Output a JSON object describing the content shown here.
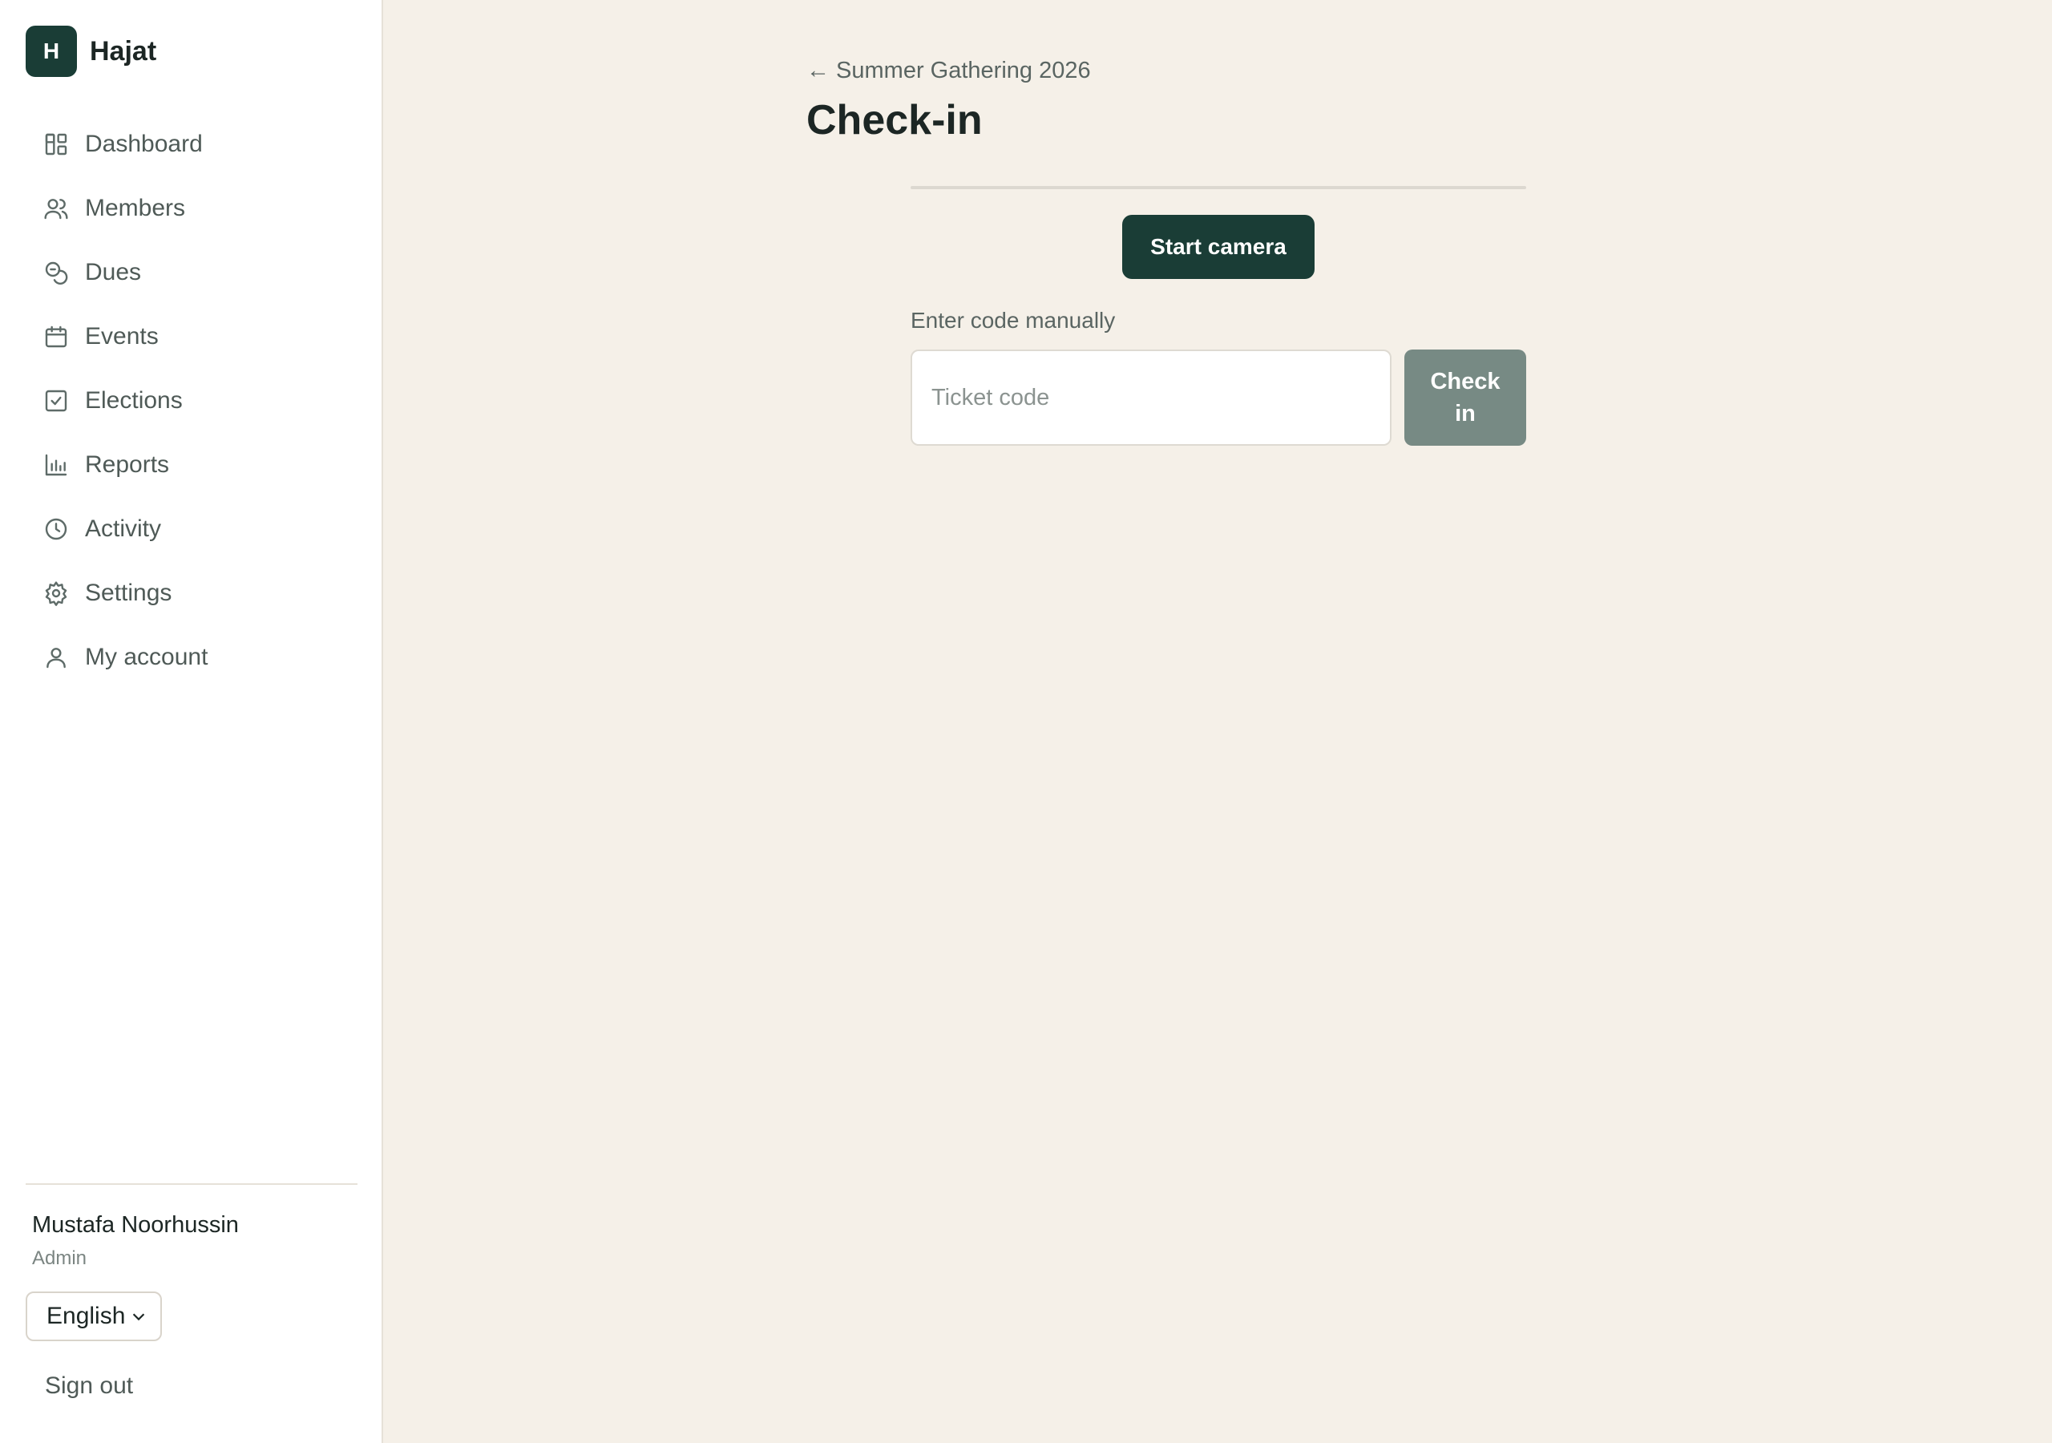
{
  "brand": {
    "initial": "H",
    "name": "Hajat"
  },
  "nav": [
    {
      "label": "Dashboard",
      "icon": "dashboard-icon"
    },
    {
      "label": "Members",
      "icon": "users-icon"
    },
    {
      "label": "Dues",
      "icon": "coins-icon"
    },
    {
      "label": "Events",
      "icon": "calendar-icon"
    },
    {
      "label": "Elections",
      "icon": "ballot-icon"
    },
    {
      "label": "Reports",
      "icon": "bar-chart-icon"
    },
    {
      "label": "Activity",
      "icon": "clock-icon"
    },
    {
      "label": "Settings",
      "icon": "gear-icon"
    },
    {
      "label": "My account",
      "icon": "user-icon"
    }
  ],
  "user": {
    "name": "Mustafa Noorhussin",
    "role": "Admin"
  },
  "language": {
    "selected": "English"
  },
  "sign_out": "Sign out",
  "main": {
    "back_link": "← Summer Gathering 2026",
    "title": "Check-in",
    "start_camera": "Start camera",
    "manual_label": "Enter code manually",
    "ticket_placeholder": "Ticket code",
    "checkin_button": "Check in"
  },
  "colors": {
    "brand": "#1a3d36",
    "background": "#f5f0e8",
    "checkin_button": "#778a84"
  }
}
